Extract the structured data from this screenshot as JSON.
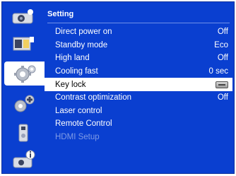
{
  "panel": {
    "title": "Setting"
  },
  "sidebar": {
    "tabs": [
      {
        "name": "picture-adjust-icon",
        "active": false
      },
      {
        "name": "screen-adjust-icon",
        "active": false
      },
      {
        "name": "setting-gear-icon",
        "active": true
      },
      {
        "name": "expanded-gear-icon",
        "active": false
      },
      {
        "name": "usb-drive-icon",
        "active": false
      },
      {
        "name": "info-icon",
        "active": false
      }
    ]
  },
  "menu": {
    "items": [
      {
        "label": "Direct power on",
        "value": "Off",
        "selected": false,
        "disabled": false
      },
      {
        "label": "Standby mode",
        "value": "Eco",
        "selected": false,
        "disabled": false
      },
      {
        "label": "High land",
        "value": "Off",
        "selected": false,
        "disabled": false
      },
      {
        "label": "Cooling fast",
        "value": "0 sec",
        "selected": false,
        "disabled": false
      },
      {
        "label": "Key lock",
        "value": "",
        "value_icon": "key-lock-icon",
        "selected": true,
        "disabled": false
      },
      {
        "label": "Contrast optimization",
        "value": "Off",
        "selected": false,
        "disabled": false
      },
      {
        "label": "Laser control",
        "value": "",
        "selected": false,
        "disabled": false
      },
      {
        "label": "Remote Control",
        "value": "",
        "selected": false,
        "disabled": false
      },
      {
        "label": "HDMI Setup",
        "value": "",
        "selected": false,
        "disabled": true
      }
    ]
  },
  "colors": {
    "background": "#0a3fd0",
    "selected_row": "#ffffff",
    "disabled_text": "#7f9be6"
  }
}
